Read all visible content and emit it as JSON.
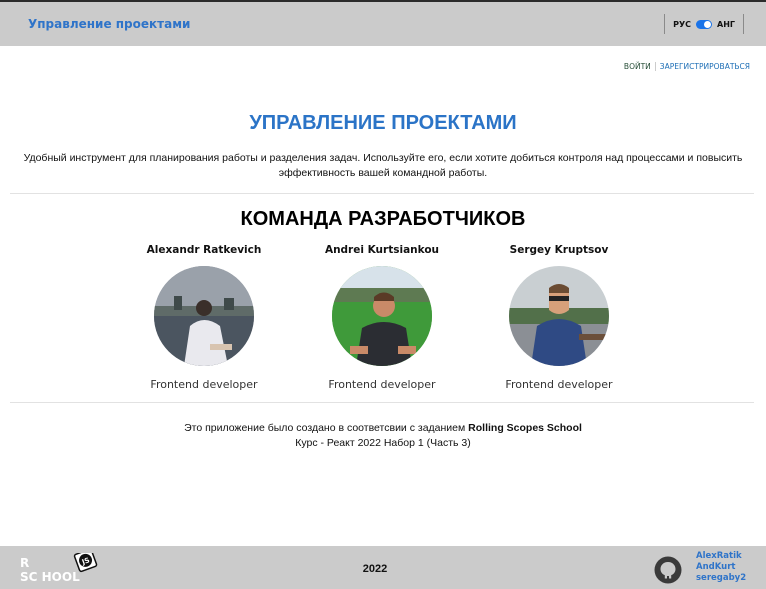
{
  "header": {
    "brand": "Управление проектами",
    "lang_ru": "РУС",
    "lang_en": "АНГ",
    "toggle_state": "on"
  },
  "auth": {
    "login": "ВОЙТИ",
    "register": "ЗАРЕГИСТРИРОВАТЬСЯ"
  },
  "main": {
    "title": "УПРАВЛЕНИЕ ПРОЕКТАМИ",
    "description": "Удобный инструмент для планирования работы и разделения задач. Используйте его, если хотите добиться контроля над процессами и повысить эффективность вашей командной работы."
  },
  "team": {
    "title": "КОМАНДА РАЗРАБОТЧИКОВ",
    "members": [
      {
        "name": "Alexandr Ratkevich",
        "role": "Frontend developer"
      },
      {
        "name": "Andrei Kurtsiankou",
        "role": "Frontend developer"
      },
      {
        "name": "Sergey Kruptsov",
        "role": "Frontend developer"
      }
    ]
  },
  "credit": {
    "line1_prefix": "Это приложение было создано в соответсвии с заданием",
    "line1_school": "Rolling Scopes School",
    "line2": "Курс - Реакт 2022 Набор 1 (Часть 3)"
  },
  "footer": {
    "year": "2022",
    "authors": [
      "AlexRatik",
      "AndKurt",
      "seregaby2"
    ],
    "logo_text_top": "R",
    "logo_text_bottom": "SC HOOL",
    "logo_badge": "JS"
  },
  "colors": {
    "accent": "#2b74c7",
    "bar_bg": "#cbcbcb",
    "toggle": "#1a73e8"
  }
}
